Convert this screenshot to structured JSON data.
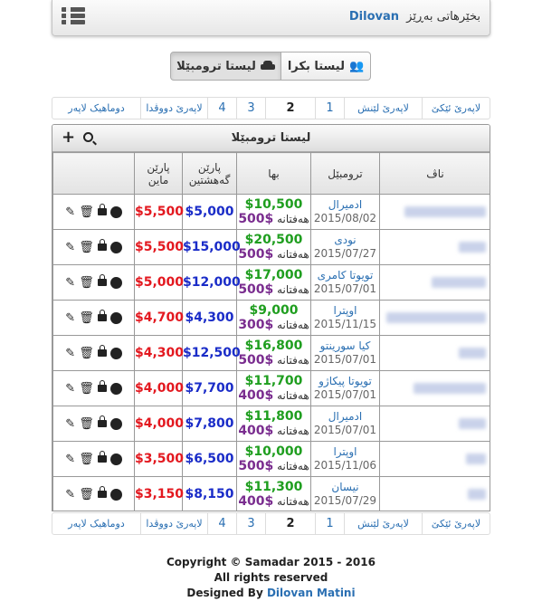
{
  "header": {
    "title": "بخێرهاتی بەڕێز",
    "user": "Dilovan",
    "menu_icon": "bars-icon"
  },
  "view_toggle": {
    "cars_list_label": "لیستا ترومبێلا",
    "buyers_list_label": "لیستا بکرا"
  },
  "pagination": {
    "first": "لاپەرێ ئێکێ",
    "prev": "لاپەرێ لێنش",
    "pages": [
      "1",
      "2",
      "3",
      "4"
    ],
    "current": "2",
    "next": "لاپەرێ دووڤدا",
    "last": "دوماهیک لاپەر"
  },
  "table": {
    "title": "لیستا ترومبێلا",
    "columns": {
      "name": "ناڤ",
      "car": "ترومبێل",
      "price": "بها",
      "paid": [
        "پارێن",
        "گەهشتین"
      ],
      "remaining": [
        "پارێن",
        "ماین"
      ]
    },
    "weekly_label": "هەفتانە",
    "rows": [
      {
        "car": "ادمیرال",
        "date": "2015/08/02",
        "price": "$10,500",
        "weekly": "$500",
        "paid": "$5,000",
        "remaining": "$5,500"
      },
      {
        "car": "نودی",
        "date": "2015/07/27",
        "price": "$20,500",
        "weekly": "$500",
        "paid": "$15,000",
        "remaining": "$5,500"
      },
      {
        "car": "تویوتا کامری",
        "date": "2015/07/01",
        "price": "$17,000",
        "weekly": "$500",
        "paid": "$12,000",
        "remaining": "$5,000"
      },
      {
        "car": "اوپترا",
        "date": "2015/11/15",
        "price": "$9,000",
        "weekly": "$300",
        "paid": "$4,300",
        "remaining": "$4,700"
      },
      {
        "car": "کیا سورینتو",
        "date": "2015/07/01",
        "price": "$16,800",
        "weekly": "$500",
        "paid": "$12,500",
        "remaining": "$4,300"
      },
      {
        "car": "تویوتا پیکاژو",
        "date": "2015/07/01",
        "price": "$11,700",
        "weekly": "$400",
        "paid": "$7,700",
        "remaining": "$4,000"
      },
      {
        "car": "ادمیرال",
        "date": "2015/07/01",
        "price": "$11,800",
        "weekly": "$400",
        "paid": "$7,800",
        "remaining": "$4,000"
      },
      {
        "car": "اوپترا",
        "date": "2015/11/06",
        "price": "$10,000",
        "weekly": "$500",
        "paid": "$6,500",
        "remaining": "$3,500"
      },
      {
        "car": "نیسان",
        "date": "2015/07/29",
        "price": "$11,300",
        "weekly": "$400",
        "paid": "$8,150",
        "remaining": "$3,150"
      }
    ]
  },
  "footer": {
    "copyright": "Copyright © Samadar 2015 - 2016",
    "rights": "All rights reserved",
    "designed_by_prefix": "Designed By",
    "designer": "Dilovan Matini"
  },
  "colors": {
    "link": "#2a6fb2",
    "price_green": "#1f9e1f",
    "weekly_purple": "#7a2d8f",
    "paid_blue": "#1a2cc8",
    "remaining_red": "#e3181f"
  }
}
